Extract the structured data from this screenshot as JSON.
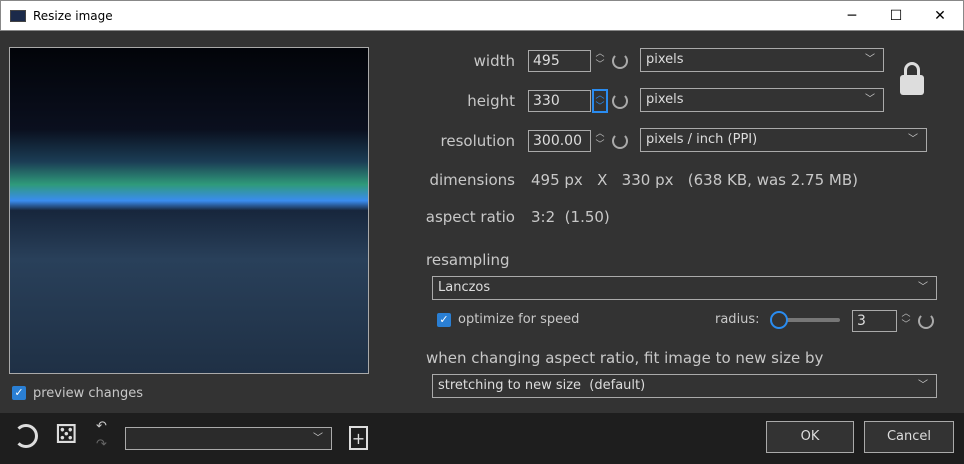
{
  "window": {
    "title": "Resize image",
    "min": "─",
    "max": "☐",
    "close": "✕"
  },
  "preview": {
    "label": "preview changes",
    "checked": true
  },
  "width": {
    "label": "width",
    "value": "495",
    "unit": "pixels"
  },
  "height": {
    "label": "height",
    "value": "330",
    "unit": "pixels"
  },
  "resolution": {
    "label": "resolution",
    "value": "300.00",
    "unit": "pixels / inch (PPI)"
  },
  "dimensions": {
    "label": "dimensions",
    "value": "495 px   X   330 px   (638 KB, was 2.75 MB)"
  },
  "aspect": {
    "label": "aspect ratio",
    "value": "3:2  (1.50)"
  },
  "resampling": {
    "label": "resampling",
    "method": "Lanczos",
    "optimize_label": "optimize for speed",
    "optimize_checked": true,
    "radius_label": "radius:",
    "radius": "3",
    "radius_slider_level": 0.05
  },
  "fit": {
    "label": "when changing aspect ratio, fit image to new size by",
    "value": "stretching to new size  (default)"
  },
  "footer": {
    "preset": "",
    "ok": "OK",
    "cancel": "Cancel"
  },
  "colors": {
    "accent": "#2a8cf0",
    "background": "#333333",
    "footer": "#1e1e1e"
  }
}
